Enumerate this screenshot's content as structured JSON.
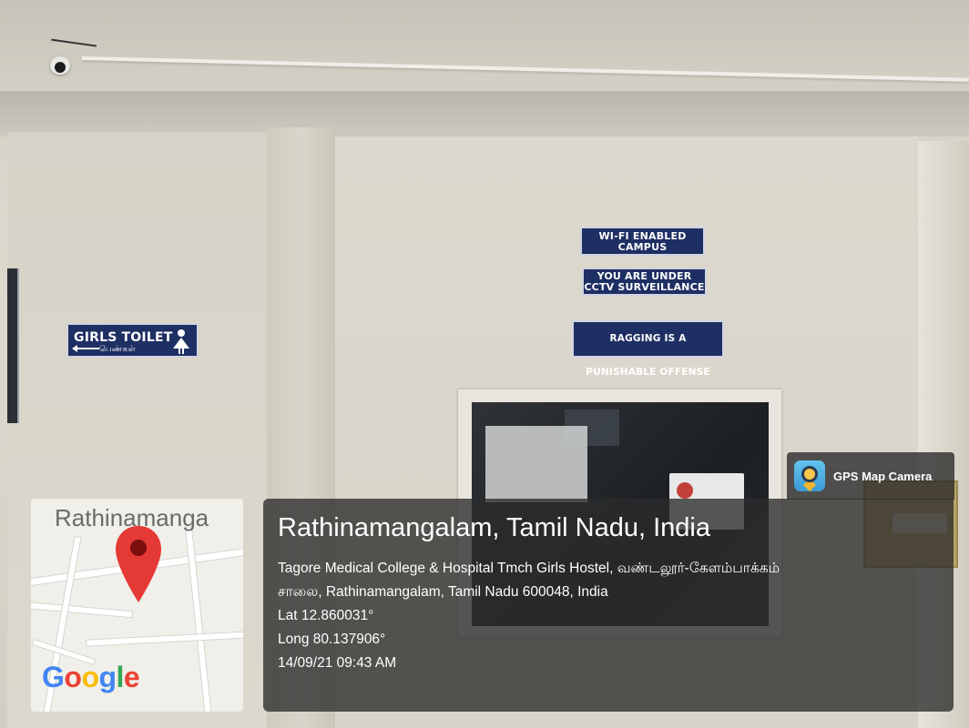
{
  "signs": {
    "wifi_line1": "WI-FI ENABLED",
    "wifi_line2": "CAMPUS",
    "cctv_line1": "YOU ARE UNDER",
    "cctv_line2": "CCTV SURVEILLANCE",
    "ragging": "RAGGING IS A PUNISHABLE OFFENSE",
    "toilet_main": "GIRLS TOILET",
    "toilet_sub": "பெண்கள்"
  },
  "gps_badge": {
    "label": "GPS Map Camera",
    "icon": "gps-map-camera-icon"
  },
  "location": {
    "title": "Rathinamangalam, Tamil Nadu, India",
    "address_line1": "Tagore Medical College & Hospital Tmch Girls Hostel, வண்டலூர்-கேளம்பாக்கம்",
    "address_line2": "சாலை, Rathinamangalam, Tamil Nadu 600048, India",
    "lat": "Lat 12.860031°",
    "long": "Long 80.137906°",
    "datetime": "14/09/21 09:43 AM"
  },
  "map": {
    "place_label": "Rathinamanga",
    "logo_text": [
      "G",
      "o",
      "o",
      "g",
      "l",
      "e"
    ],
    "logo_colors": [
      "#4285F4",
      "#EA4335",
      "#FBBC05",
      "#4285F4",
      "#34A853",
      "#EA4335"
    ],
    "pin_color": "#E53935",
    "pin_icon": "location-pin-icon"
  }
}
